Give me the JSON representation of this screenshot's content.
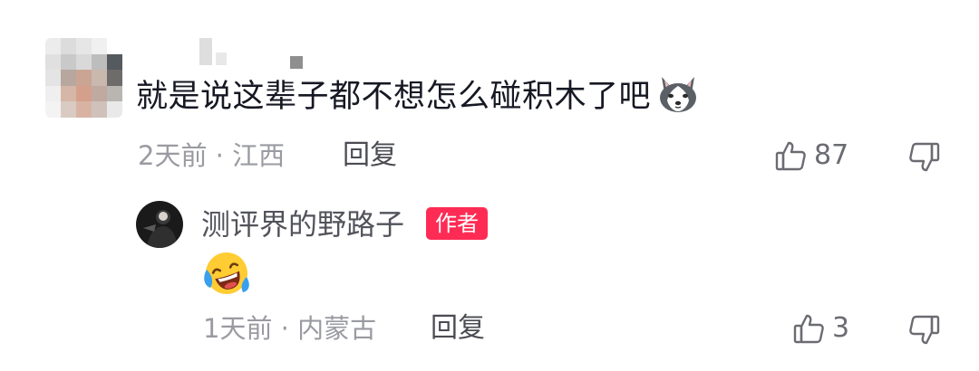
{
  "comment": {
    "text": "就是说这辈子都不想怎么碰积木了吧",
    "inline_emoji": "husky-dog-emoji",
    "time_location": "2天前 · 江西",
    "reply_label": "回复",
    "like_count": "87"
  },
  "reply": {
    "author_name": "测评界的野路子",
    "author_badge": "作者",
    "content_emoji": "laughing-crying-emoji",
    "time_location": "1天前 · 内蒙古",
    "reply_label": "回复",
    "like_count": "3"
  },
  "colors": {
    "badge_bg": "#fe2c55",
    "text_primary": "#161823",
    "text_meta": "#9a9ba1"
  }
}
